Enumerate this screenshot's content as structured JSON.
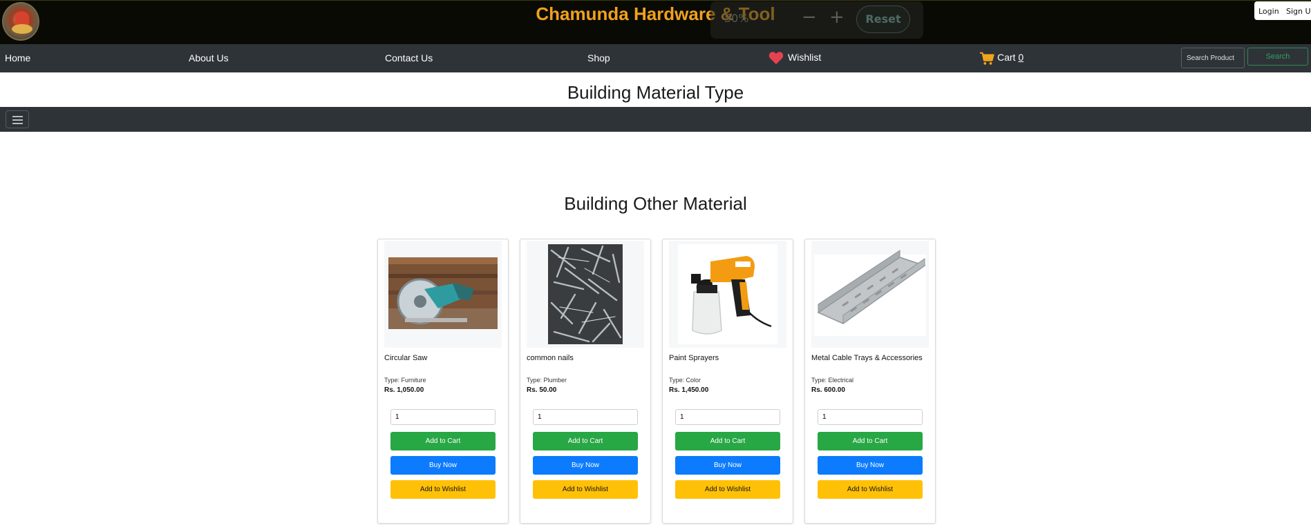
{
  "header": {
    "brand": "Chamunda Hardware & Tool",
    "zoom_level": "50%",
    "zoom_minus": "−",
    "zoom_plus": "+",
    "zoom_reset": "Reset",
    "login": "Login",
    "signup": "Sign Up"
  },
  "nav": {
    "home": "Home",
    "about": "About Us",
    "contact": "Contact Us",
    "shop": "Shop",
    "wishlist": "Wishlist",
    "cart_label": "Cart",
    "cart_count": "0",
    "search_placeholder": "Search Product",
    "search_button": "Search"
  },
  "sections": {
    "type_title": "Building Material Type",
    "other_title": "Building Other Material"
  },
  "colors": {
    "brand": "#f0a21c",
    "navbar": "#2e3338",
    "add_to_cart": "#28a745",
    "buy_now": "#0d7bfd",
    "add_to_wishlist": "#ffc107",
    "wishlist_heart": "#e8424f"
  },
  "icons": [
    "heart-icon",
    "cart-icon",
    "hamburger-icon"
  ],
  "products": [
    {
      "name": "Circular Saw",
      "type": "Type: Furniture",
      "price": "Rs. 1,050.00",
      "quantity": "1",
      "add_to_cart": "Add to Cart",
      "buy_now": "Buy Now",
      "add_to_wishlist": "Add to Wishlist"
    },
    {
      "name": "common nails",
      "type": "Type: Plumber",
      "price": "Rs. 50.00",
      "quantity": "1",
      "add_to_cart": "Add to Cart",
      "buy_now": "Buy Now",
      "add_to_wishlist": "Add to Wishlist"
    },
    {
      "name": "Paint Sprayers",
      "type": "Type: Color",
      "price": "Rs. 1,450.00",
      "quantity": "1",
      "add_to_cart": "Add to Cart",
      "buy_now": "Buy Now",
      "add_to_wishlist": "Add to Wishlist"
    },
    {
      "name": "Metal Cable Trays & Accessories",
      "type": "Type: Electrical",
      "price": "Rs. 600.00",
      "quantity": "1",
      "add_to_cart": "Add to Cart",
      "buy_now": "Buy Now",
      "add_to_wishlist": "Add to Wishlist"
    }
  ]
}
